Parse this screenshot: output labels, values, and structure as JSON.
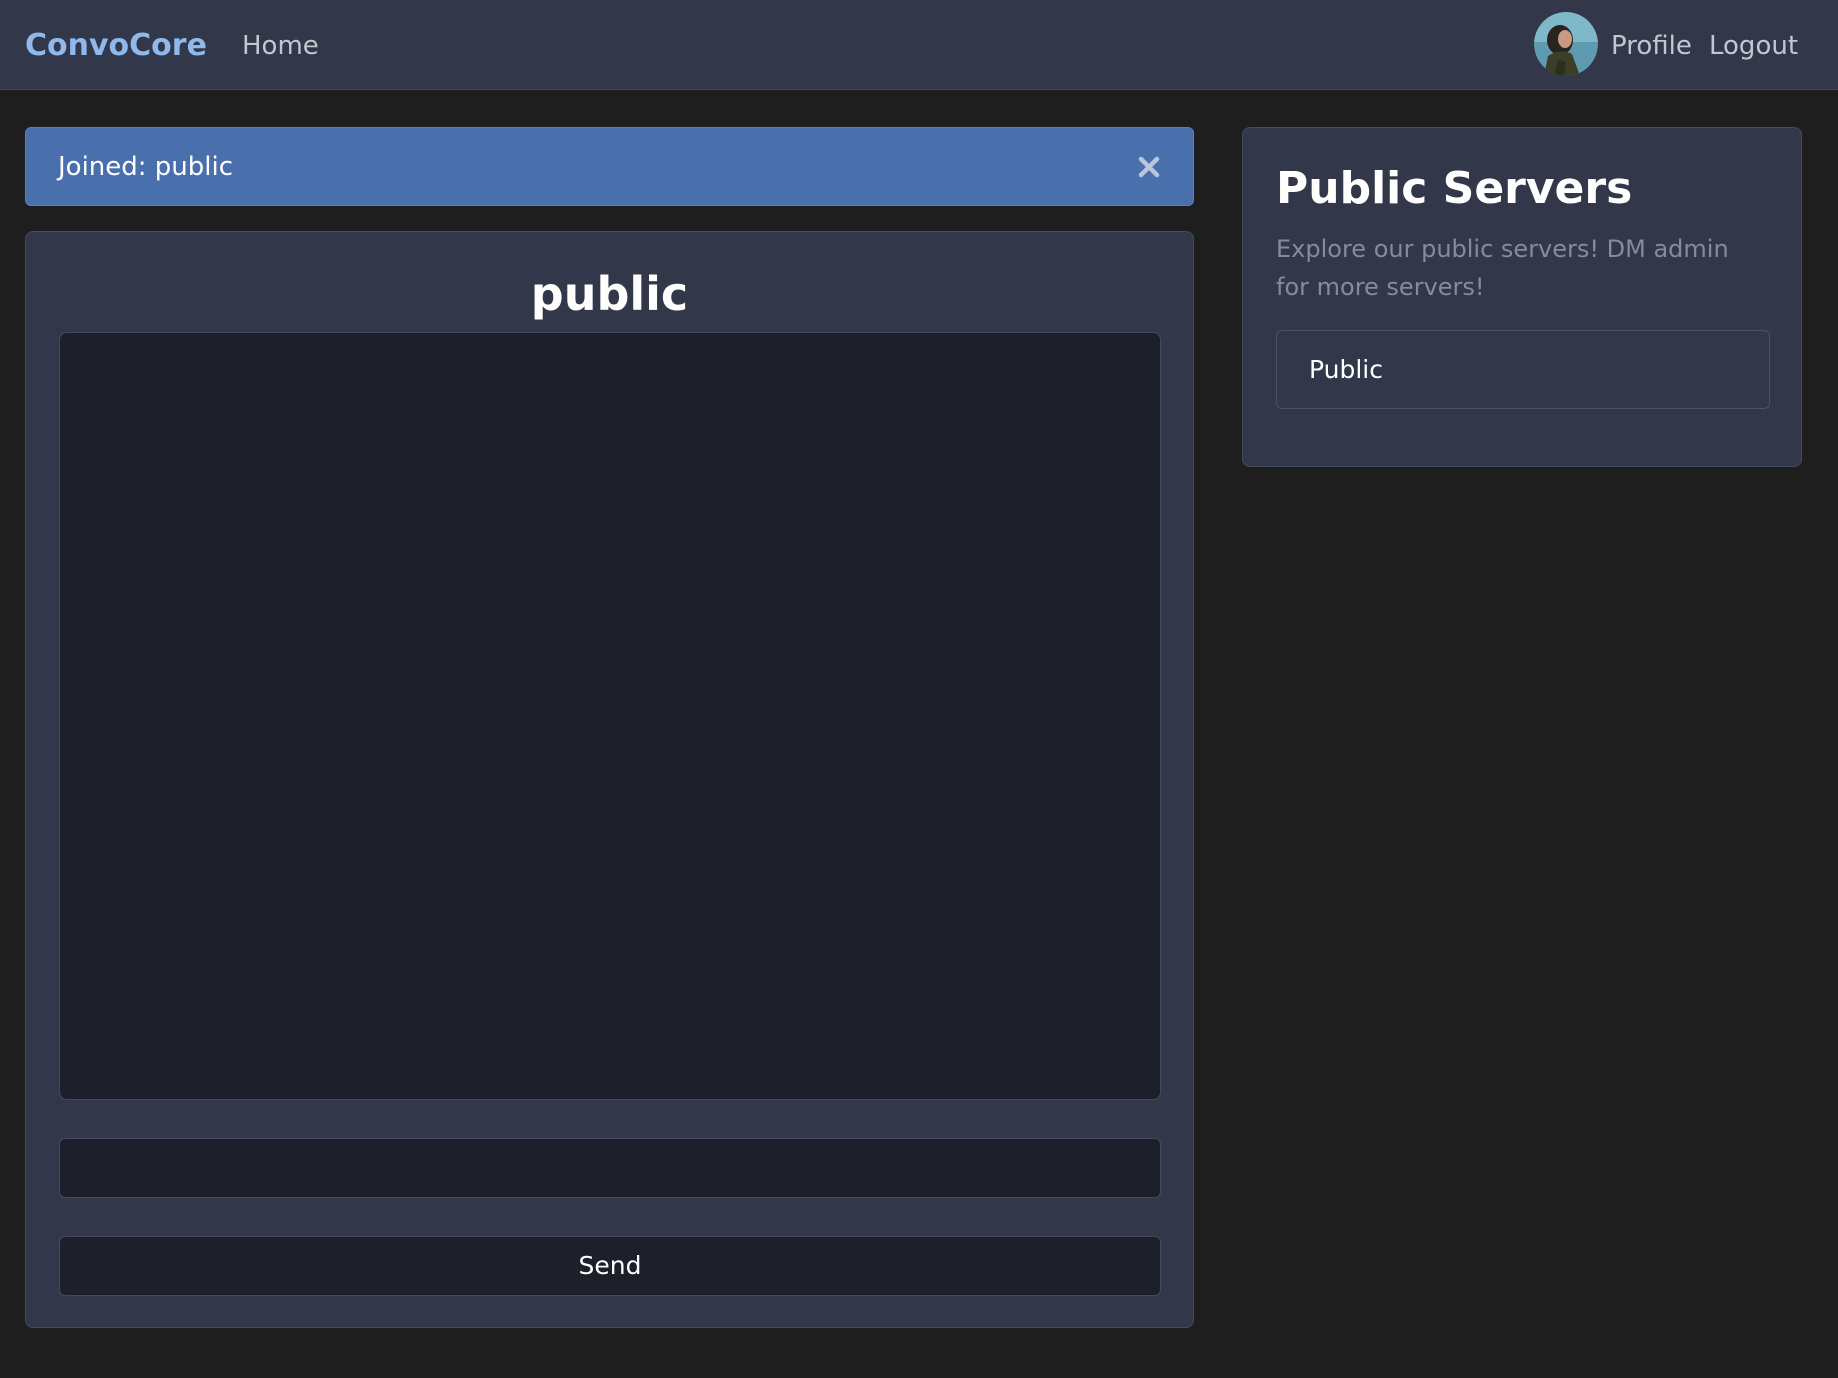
{
  "navbar": {
    "brand": "ConvoCore",
    "home_label": "Home",
    "profile_label": "Profile",
    "logout_label": "Logout",
    "avatar_icon": "user-avatar"
  },
  "alert": {
    "message": "Joined: public",
    "close_icon": "close-icon"
  },
  "chat": {
    "room_title": "public",
    "messages": [],
    "input_value": "",
    "input_placeholder": "",
    "send_label": "Send"
  },
  "servers": {
    "title": "Public Servers",
    "description": "Explore our public servers! DM admin for more servers!",
    "items": [
      {
        "label": "Public"
      }
    ]
  },
  "colors": {
    "page_bg": "#1e1e1e",
    "navbar_bg": "#323849",
    "brand": "#8fb8ec",
    "alert_bg": "#4a6fad",
    "card_bg": "#323849",
    "inner_bg": "#1d202a",
    "muted_text": "#858b98"
  }
}
